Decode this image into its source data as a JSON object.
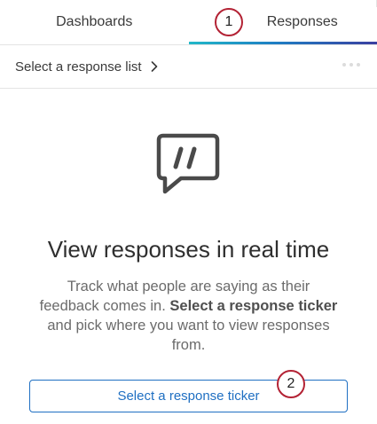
{
  "tabs": [
    {
      "label": "Dashboards",
      "active": false
    },
    {
      "label": "Responses",
      "active": true
    }
  ],
  "callouts": {
    "first": "1",
    "second": "2"
  },
  "response_list": {
    "label": "Select a response list",
    "chevron_icon": "chevron-right-icon",
    "more_icon": "more-horizontal-icon"
  },
  "empty_state": {
    "icon": "quote-chat-bubble-icon",
    "heading": "View responses in real time",
    "desc_part1": "Track what people are saying as their feedback comes in.",
    "desc_bold": "Select a response ticker",
    "desc_part2": "and pick where you want to view responses from.",
    "button_label": "Select a response ticker"
  },
  "colors": {
    "accent": "#1f6fc2",
    "callout_border": "#b32234",
    "underline_start": "#22b8c8",
    "underline_end": "#3a3fa0"
  }
}
